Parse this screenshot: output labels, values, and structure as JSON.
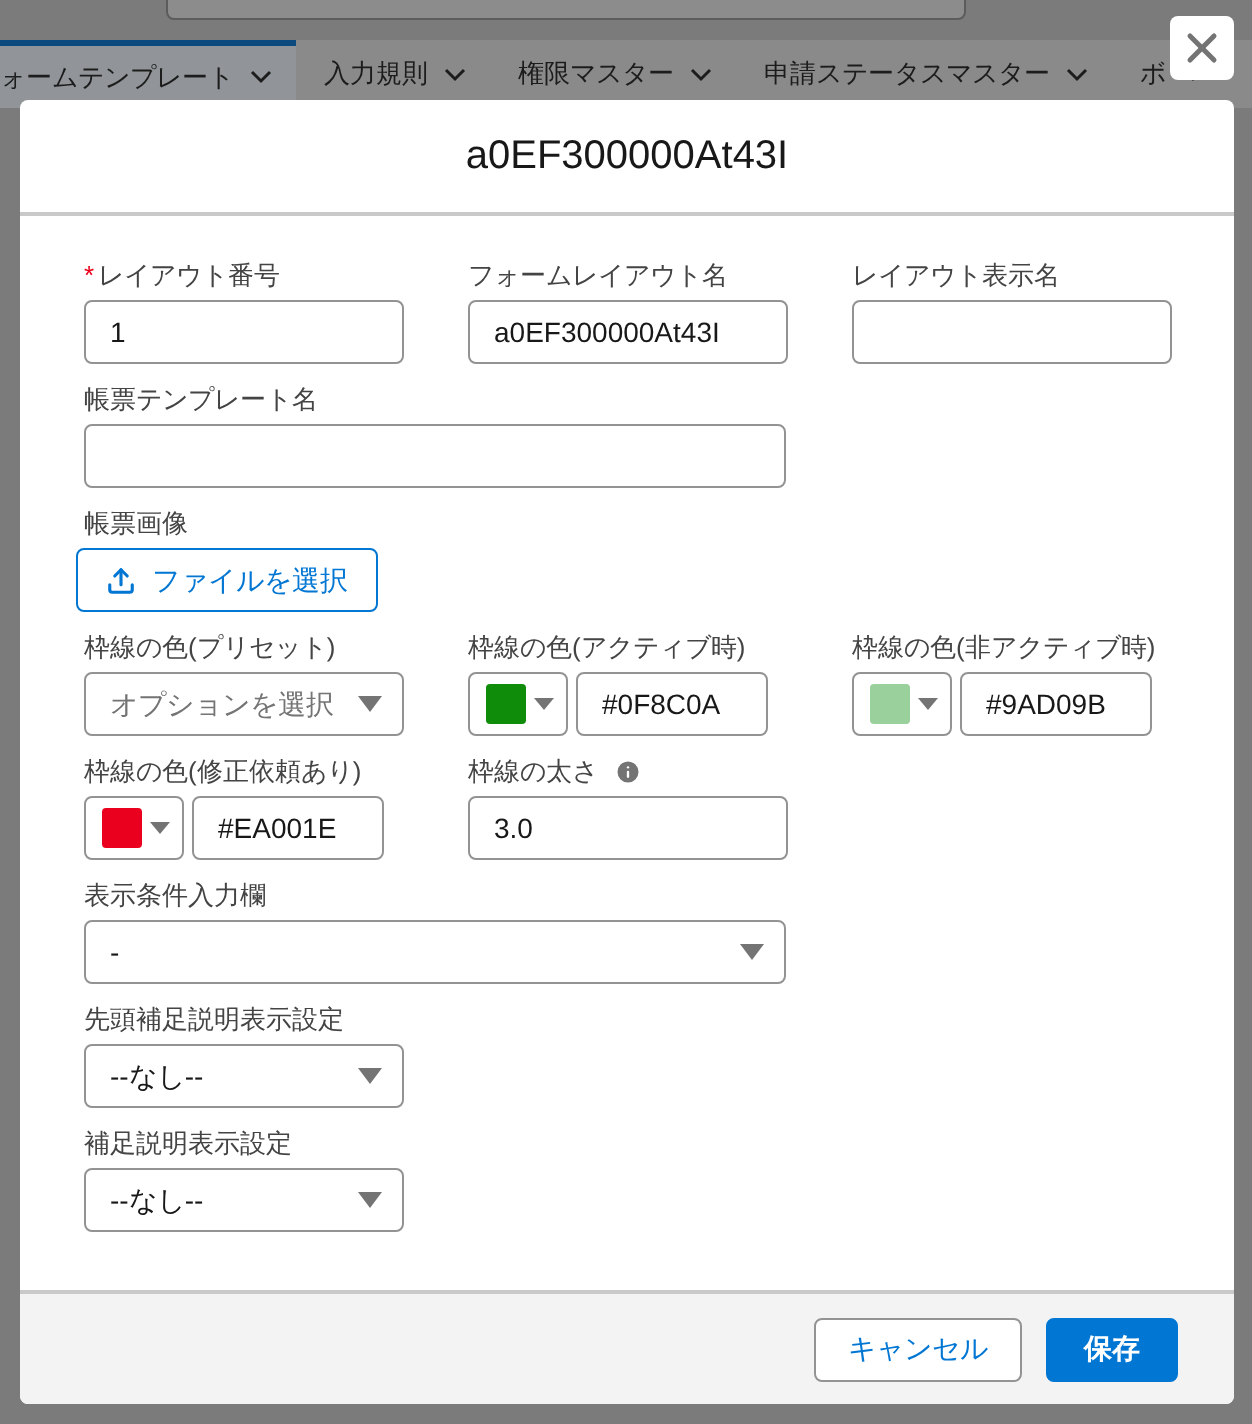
{
  "background_tabs": [
    {
      "label": "ォームテンプレート",
      "selected": true
    },
    {
      "label": "入力規則",
      "selected": false
    },
    {
      "label": "権限マスター",
      "selected": false
    },
    {
      "label": "申請ステータスマスター",
      "selected": false
    },
    {
      "label": "ボ",
      "selected": false
    }
  ],
  "modal": {
    "title": "a0EF300000At43I",
    "rows": [
      [
        {
          "kind": "text",
          "label": "レイアウト番号",
          "required_mark": "*",
          "value": "1"
        },
        {
          "kind": "text",
          "label": "フォームレイアウト名",
          "value": "a0EF300000At43I"
        },
        {
          "kind": "text",
          "label": "レイアウト表示名"
        }
      ],
      [
        {
          "kind": "text",
          "label": "帳票テンプレート名",
          "wide": true
        }
      ],
      [
        {
          "kind": "file",
          "label": "帳票画像",
          "button": "ファイルを選択"
        }
      ],
      [
        {
          "kind": "select",
          "label": "枠線の色(プリセット)",
          "placeholder": "オプションを選択"
        },
        {
          "kind": "color",
          "label": "枠線の色(アクティブ時)",
          "color": "#0f8c0a",
          "value": "#0F8C0A"
        },
        {
          "kind": "color",
          "label": "枠線の色(非アクティブ時)",
          "color": "#9ad09b",
          "value": "#9AD09B"
        }
      ],
      [
        {
          "kind": "color",
          "label": "枠線の色(修正依頼あり)",
          "color": "#ea001e",
          "value": "#EA001E"
        },
        {
          "kind": "text",
          "label": "枠線の太さ",
          "info": true,
          "value": "3.0"
        }
      ],
      [
        {
          "kind": "select",
          "label": "表示条件入力欄",
          "value": "-",
          "wide": true
        }
      ],
      [
        {
          "kind": "select",
          "label": "先頭補足説明表示設定",
          "value": "--なし--"
        }
      ],
      [
        {
          "kind": "select",
          "label": "補足説明表示設定",
          "value": "--なし--"
        }
      ]
    ],
    "buttons": [
      {
        "label": "キャンセル",
        "kind": "neutral"
      },
      {
        "label": "保存",
        "kind": "brand"
      }
    ]
  }
}
